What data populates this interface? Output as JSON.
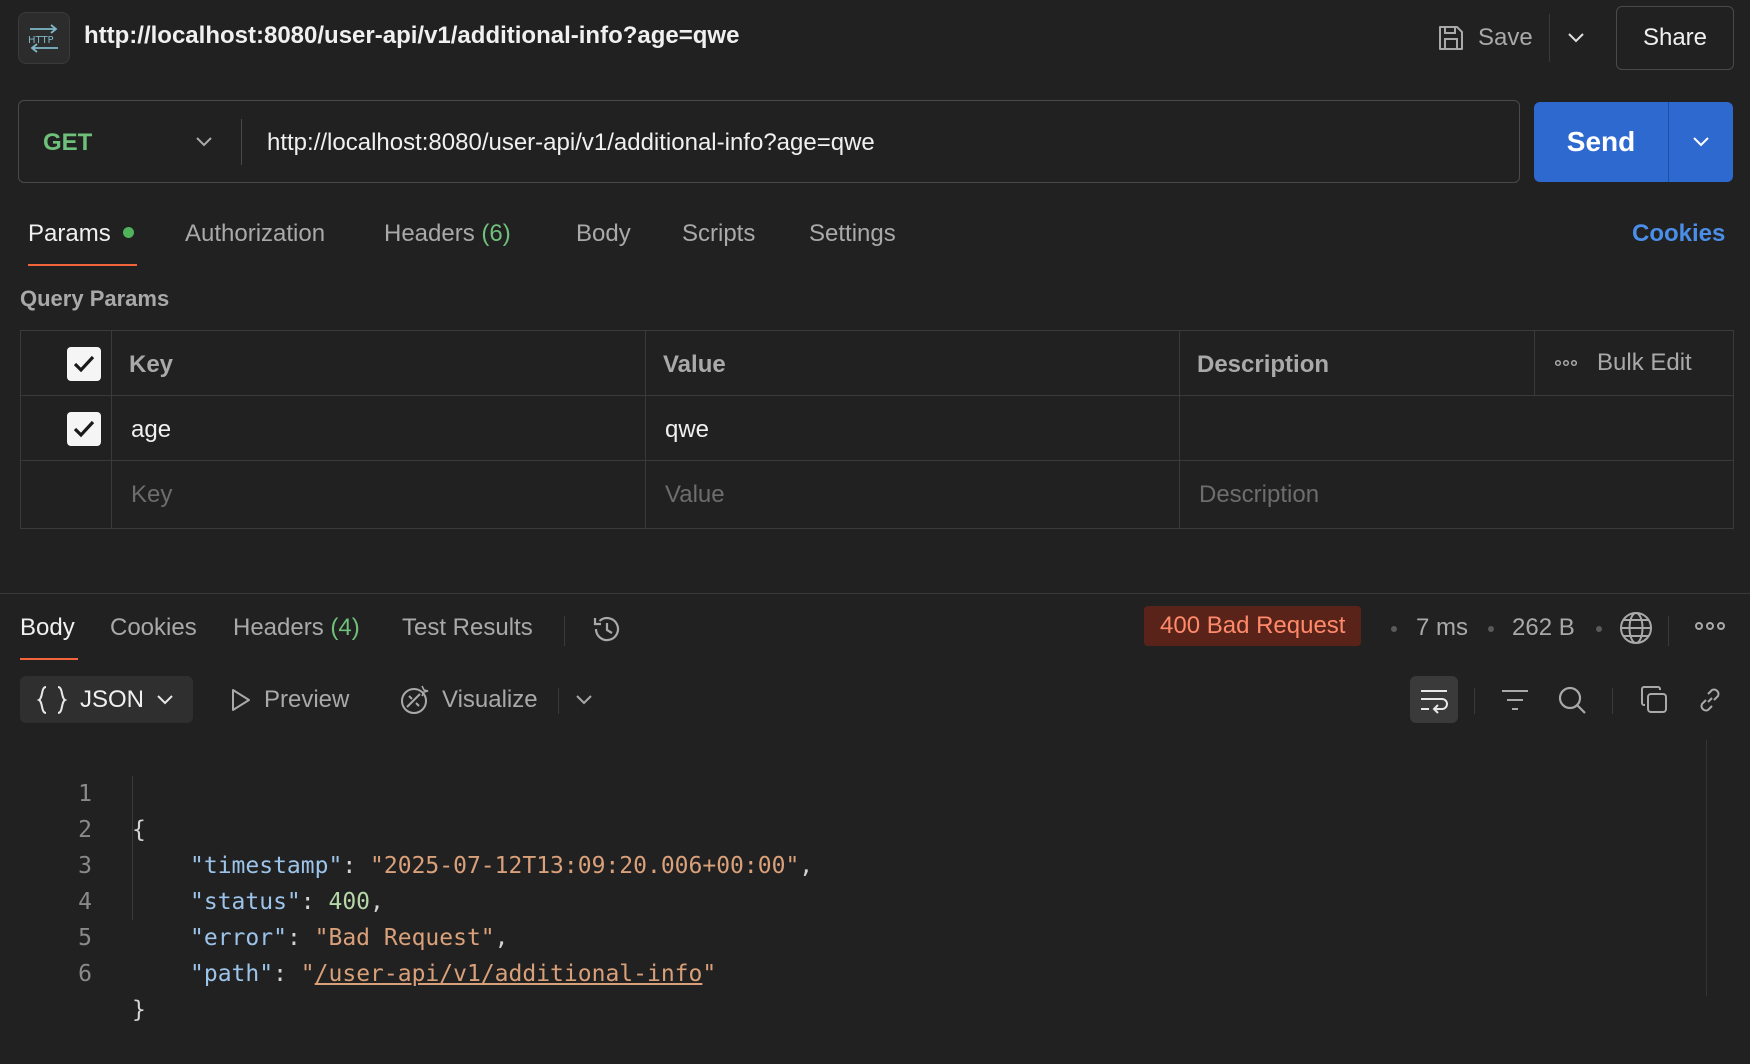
{
  "header": {
    "icon": "http-icon",
    "title": "http://localhost:8080/user-api/v1/additional-info?age=qwe",
    "save_label": "Save",
    "share_label": "Share"
  },
  "request": {
    "method": "GET",
    "url": "http://localhost:8080/user-api/v1/additional-info?age=qwe",
    "send_label": "Send"
  },
  "request_tabs": {
    "params": "Params",
    "authorization": "Authorization",
    "headers": "Headers",
    "headers_count": "(6)",
    "body": "Body",
    "scripts": "Scripts",
    "settings": "Settings",
    "cookies": "Cookies"
  },
  "query_params": {
    "title": "Query Params",
    "columns": {
      "key": "Key",
      "value": "Value",
      "description": "Description"
    },
    "bulk_edit": "Bulk Edit",
    "rows": [
      {
        "checked": true,
        "key": "age",
        "value": "qwe",
        "description": ""
      }
    ],
    "placeholders": {
      "key": "Key",
      "value": "Value",
      "description": "Description"
    }
  },
  "response": {
    "tabs": {
      "body": "Body",
      "cookies": "Cookies",
      "headers": "Headers",
      "headers_count": "(4)",
      "test_results": "Test Results"
    },
    "status": "400 Bad Request",
    "time": "7 ms",
    "size": "262 B",
    "format": "JSON",
    "preview": "Preview",
    "visualize": "Visualize",
    "body_lines": [
      {
        "num": "1",
        "text": "{"
      },
      {
        "num": "2",
        "key": "\"timestamp\"",
        "value": "\"2025-07-12T13:09:20.006+00:00\""
      },
      {
        "num": "3",
        "key": "\"status\"",
        "value": "400"
      },
      {
        "num": "4",
        "key": "\"error\"",
        "value": "\"Bad Request\""
      },
      {
        "num": "5",
        "key": "\"path\"",
        "value": "/user-api/v1/additional-info"
      },
      {
        "num": "6",
        "text": "}"
      }
    ]
  },
  "colors": {
    "accent_blue": "#2e69cf",
    "method_green": "#6ec07a",
    "tab_underline": "#f2643a",
    "error_badge": "#5a231a"
  }
}
